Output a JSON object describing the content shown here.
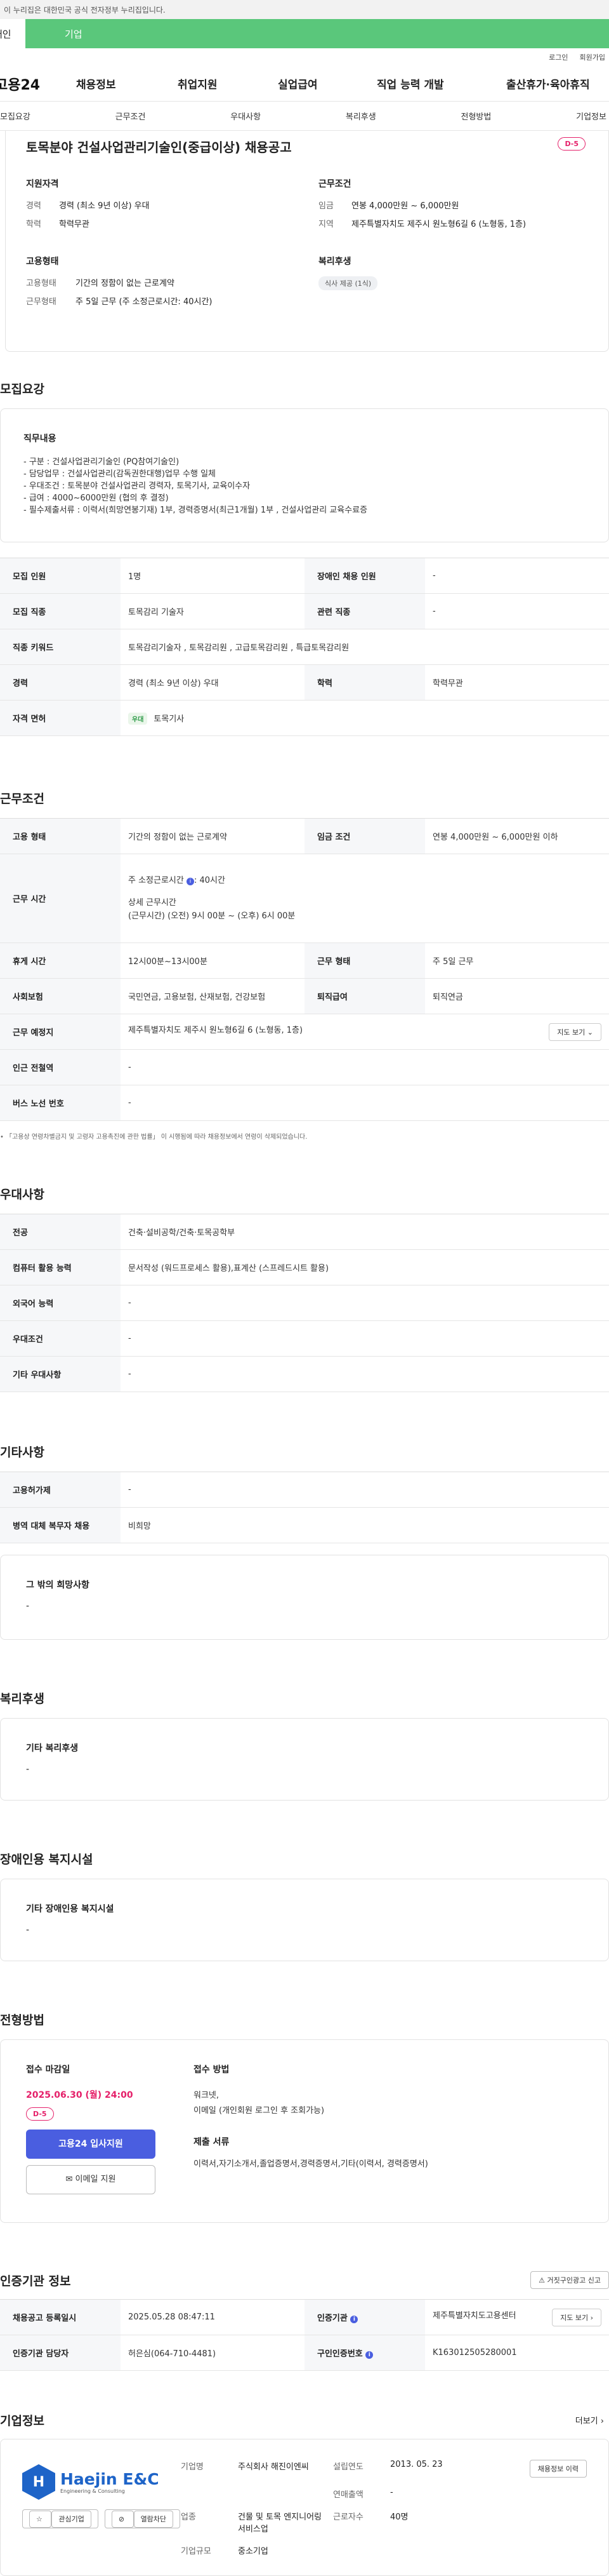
{
  "gov_notice": "이 누리집은 대한민국 공식 전자정부 누리집입니다.",
  "tabs": {
    "individual": "개인",
    "company": "기업"
  },
  "util": {
    "login": "로그인",
    "signup": "회원가입"
  },
  "logo": "고용24",
  "gnb": [
    "채용정보",
    "취업지원",
    "실업급여",
    "직업 능력 개발",
    "출산휴가·육아휴직"
  ],
  "anchors": [
    "모집요강",
    "근무조건",
    "우대사항",
    "복리후생",
    "전형방법",
    "기업정보"
  ],
  "title": "토목분야 건설사업관리기술인(중급이상) 채용공고",
  "dday": "D-5",
  "summary": {
    "qual": {
      "h": "지원자격",
      "rows": [
        {
          "k": "경력",
          "v": "경력 (최소 9년 이상) 우대"
        },
        {
          "k": "학력",
          "v": "학력무관"
        }
      ]
    },
    "cond": {
      "h": "근무조건",
      "rows": [
        {
          "k": "임금",
          "v": "연봉 4,000만원 ~ 6,000만원"
        },
        {
          "k": "지역",
          "v": "제주특별자치도 제주시 원노형6길 6 (노형동, 1층)"
        }
      ]
    },
    "emp": {
      "h": "고용형태",
      "rows": [
        {
          "k": "고용형태",
          "v": "기간의 정함이 없는 근로계약"
        },
        {
          "k": "근무형태",
          "v": "주 5일 근무 (주 소정근로시간: 40시간)"
        }
      ]
    },
    "welfare": {
      "h": "복리후생",
      "chip": "식사 제공 (1식)"
    }
  },
  "recruit": {
    "title": "모집요강",
    "duty_h": "직무내용",
    "duty_lines": [
      "- 구분 : 건설사업관리기술인 (PQ참여기술인)",
      "- 담당업무 : 건설사업관리(감독권한대행)업무 수행 일체",
      "- 우대조건 : 토목분야 건설사업관리 경력자, 토목기사, 교육이수자",
      "- 급여 : 4000~6000만원 (협의 후 결정)",
      "- 필수제출서류 : 이력서(희망연봉기재) 1부, 경력증명서(최근1개월) 1부 , 건설사업관리 교육수료증"
    ],
    "rows": [
      {
        "k1": "모집 인원",
        "v1": "1명",
        "k2": "장애인 채용 인원",
        "v2": "-"
      },
      {
        "k1": "모집 직종",
        "v1": "토목감리 기술자",
        "k2": "관련 직종",
        "v2": "-"
      },
      {
        "k1": "직종 키워드",
        "v1": "토목감리기술자 , 토목감리원 , 고급토목감리원 , 특급토목감리원"
      },
      {
        "k1": "경력",
        "v1": "경력 (최소 9년 이상) 우대",
        "k2": "학력",
        "v2": "학력무관"
      },
      {
        "k1": "자격 면허",
        "cert_chip": "우대",
        "v1": "토목기사"
      }
    ]
  },
  "conditions": {
    "title": "근무조건",
    "emp_type_k": "고용 형태",
    "emp_type_v": "기간의 정함이 없는 근로계약",
    "wage_k": "임금 조건",
    "wage_v": "연봉 4,000만원 ~ 6,000만원 이하",
    "hours_k": "근무 시간",
    "hours_line1": "주 소정근로시간",
    "hours_line1_val": ": 40시간",
    "hours_line2": "상세 근무시간",
    "hours_line3": "(근무시간) (오전) 9시 00분 ~ (오후) 6시 00분",
    "break_k": "휴게 시간",
    "break_v": "12시00분~13시00분",
    "worktype_k": "근무 형태",
    "worktype_v": "주 5일 근무",
    "insurance_k": "사회보험",
    "insurance_v": "국민연금, 고용보험, 산재보험, 건강보험",
    "retire_k": "퇴직급여",
    "retire_v": "퇴직연금",
    "loc_k": "근무 예정지",
    "loc_v": "제주특별자치도 제주시 원노형6길 6 (노형동, 1층)",
    "map_btn": "지도 보기",
    "subway_k": "인근 전철역",
    "subway_v": "-",
    "bus_k": "버스 노선 번호",
    "bus_v": "-",
    "hint": "「고용상 연령차별금지 및 고령자 고용촉진에 관한 법률」 이 시행됨에 따라 채용정보에서 연령이 삭제되었습니다."
  },
  "preference": {
    "title": "우대사항",
    "rows": [
      {
        "k": "전공",
        "v": "건축·설비공학/건축·토목공학부"
      },
      {
        "k": "컴퓨터 활용 능력",
        "v": "문서작성 (워드프로세스 활용),표계산 (스프레드시트 활용)"
      },
      {
        "k": "외국어 능력",
        "v": "-"
      },
      {
        "k": "우대조건",
        "v": "-"
      },
      {
        "k": "기타 우대사항",
        "v": "-"
      }
    ]
  },
  "etc": {
    "title": "기타사항",
    "rows": [
      {
        "k": "고용허가제",
        "v": "-"
      },
      {
        "k": "병역 대체 복무자 채용",
        "v": "비희망"
      }
    ],
    "hope_h": "그 밖의 희망사항",
    "hope_v": "-"
  },
  "welfare": {
    "title": "복리후생",
    "h": "기타 복리후생",
    "v": "-"
  },
  "disabled": {
    "title": "장애인용 복지시설",
    "h": "기타 장애인용 복지시설",
    "v": "-"
  },
  "process": {
    "title": "전형방법",
    "deadline_h": "접수 마감일",
    "deadline": "2025.06.30 (월) 24:00",
    "dday": "D-5",
    "apply_btn": "고용24 입사지원",
    "email_btn": "이메일 지원",
    "method_h": "접수 방법",
    "methods": [
      "워크넷,",
      "이메일 (개인회원 로그인 후 조회가능)"
    ],
    "docs_h": "제출 서류",
    "docs": "이력서,자기소개서,졸업증명서,경력증명서,기타(이력서, 경력증명서)"
  },
  "cert": {
    "title": "인증기관 정보",
    "report_btn": "거짓구인광고 신고",
    "reg_k": "채용공고 등록일시",
    "reg_v": "2025.05.28 08:47:11",
    "org_k": "인증기관",
    "org_v": "제주특별자치도고용센터",
    "org_map": "지도 보기",
    "mgr_k": "인증기관 담당자",
    "mgr_v": "허은심(064-710-4481)",
    "no_k": "구인인증번호",
    "no_v": "K163012505280001"
  },
  "company": {
    "title": "기업정보",
    "more": "더보기",
    "logo_text": "Haejin E&C",
    "logo_sub": "Engineering & Consulting",
    "fav_btn": "관심기업",
    "block_btn": "열람차단",
    "hire_btn": "채용정보 이력",
    "name_k": "기업명",
    "name_v": "주식회사 해진이엔씨",
    "est_k": "설립연도",
    "est_v": "2013. 05. 23",
    "sales_k": "연매출액",
    "sales_v": "-",
    "ind_k": "업종",
    "ind_v": "건물 및 토목 엔지니어링 서비스업",
    "emp_k": "근로자수",
    "emp_v": "40명",
    "size_k": "기업규모",
    "size_v": "중소기업"
  },
  "colors": {
    "green": "#5ac77b",
    "pink": "#e5206a",
    "blue": "#4a5ee0",
    "brand": "#1e64c8"
  }
}
